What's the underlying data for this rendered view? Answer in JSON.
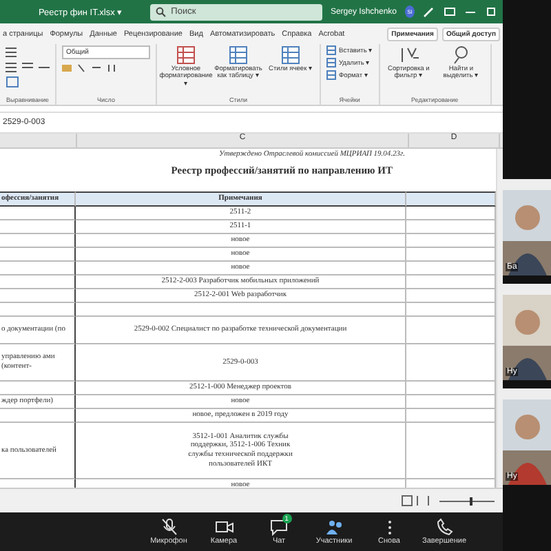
{
  "window": {
    "title": "Реестр фин IT.xlsx ▾",
    "search": {
      "placeholder": "Поиск"
    },
    "user": "Sergey Ishchenko",
    "user_initial": "SI"
  },
  "ribbon": {
    "tabs": [
      {
        "label": "а страницы",
        "selected": false
      },
      {
        "label": "Формулы",
        "selected": false
      },
      {
        "label": "Данные",
        "selected": false
      },
      {
        "label": "Рецензирование",
        "selected": false
      },
      {
        "label": "Вид",
        "selected": false
      },
      {
        "label": "Автоматизировать",
        "selected": false
      },
      {
        "label": "Справка",
        "selected": false
      },
      {
        "label": "Acrobat",
        "selected": false
      }
    ],
    "actions": [
      "Примечания",
      "Общий доступ"
    ],
    "number_format": "Общий",
    "groups": [
      {
        "label": "Выравнивание"
      },
      {
        "label": "Число"
      },
      {
        "label": "Стили",
        "buttons": [
          "Условное форматирование ▾",
          "Форматировать как таблицу ▾",
          "Стили ячеек ▾"
        ]
      },
      {
        "label": "Ячейки",
        "buttons": [
          "Вставить ▾",
          "Удалить ▾",
          "Формат ▾"
        ]
      },
      {
        "label": "Редактирование",
        "buttons": [
          "Сортировка и фильтр ▾",
          "Найти и выделить ▾"
        ]
      }
    ]
  },
  "formula_bar": {
    "value": "2529-0-003"
  },
  "sheet": {
    "columns": [
      "C",
      "D"
    ],
    "approval": "Утверждено Отраслевой комиссией МЦРИАП 19.04.23г.",
    "title": "Реестр профессий/занятий по направлению ИТ",
    "header": [
      "офессия/занятия",
      "Примечания"
    ],
    "rows": [
      {
        "column_b": "",
        "note": "2511-2"
      },
      {
        "column_b": "",
        "note": "2511-1"
      },
      {
        "column_b": "",
        "note": "новое"
      },
      {
        "column_b": "",
        "note": "новое"
      },
      {
        "column_b": "",
        "note": "новое"
      },
      {
        "column_b": "",
        "note": "2512-2-003 Разработчик мобильных приложений"
      },
      {
        "column_b": "",
        "note": "2512-2-001 Web разработчик"
      },
      {
        "column_b": "",
        "note": ""
      },
      {
        "column_b": "о документации (по",
        "note": "2529-0-002 Специалист по разработке технической документации"
      },
      {
        "column_b": "управлению ами (контент-",
        "note": "2529-0-003"
      },
      {
        "column_b": "",
        "note": "2512-1-000 Менеджер проектов"
      },
      {
        "column_b": "ждер портфели)",
        "note": "новое"
      },
      {
        "column_b": "",
        "note": "новое, предложен в 2019 году"
      },
      {
        "column_b": "ка пользователей",
        "note": "3512-1-001 Аналитик службы поддержки, 3512-1-006 Техник службы технической поддержки пользователей ИКТ"
      },
      {
        "column_b": "",
        "note": "новое"
      }
    ]
  },
  "meeting": {
    "tiles": [
      "Ба",
      "Ну",
      "Ну"
    ],
    "controls": [
      {
        "kind": "mic",
        "label": "Микрофон"
      },
      {
        "kind": "camera",
        "label": "Камера"
      },
      {
        "kind": "chat",
        "label": "Чат",
        "badge": "1"
      },
      {
        "kind": "people",
        "label": "Участники"
      },
      {
        "kind": "more",
        "label": "Снова"
      },
      {
        "kind": "end",
        "label": "Завершение"
      }
    ]
  }
}
